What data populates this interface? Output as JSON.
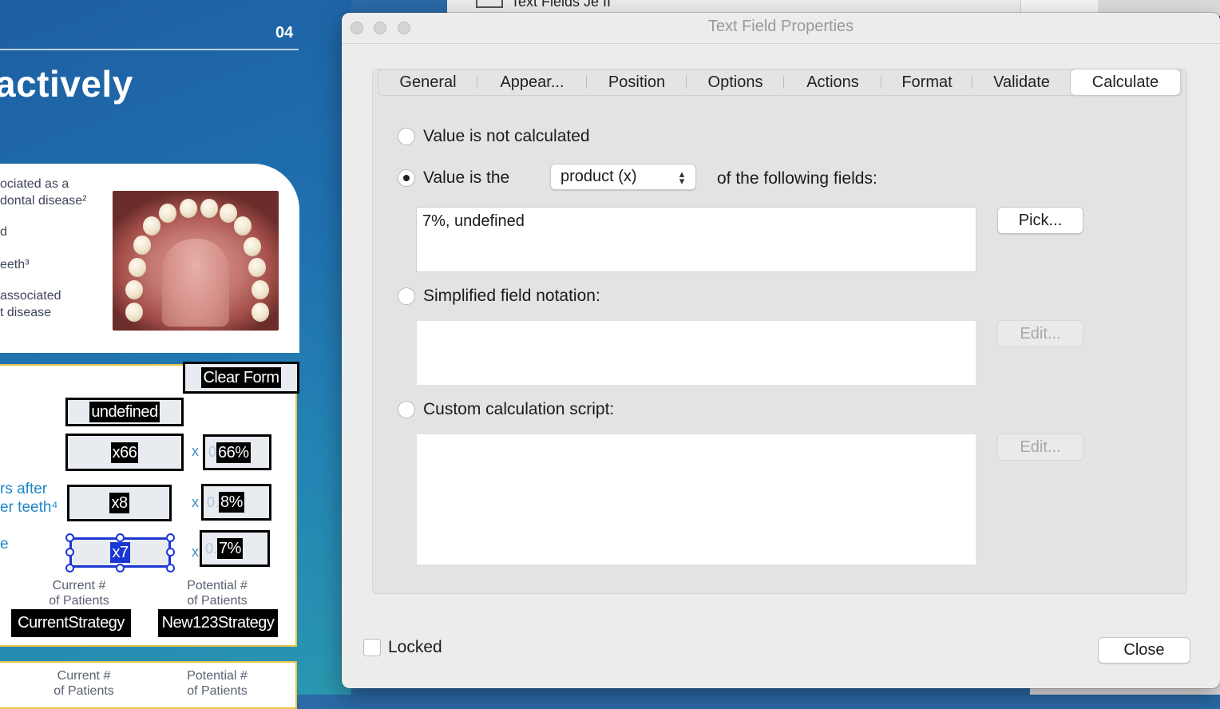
{
  "document": {
    "page_number": "04",
    "headline": "actively",
    "card_lines": [
      "ociated as a",
      "dontal disease²",
      "d",
      "eeth³",
      "associated",
      "t disease"
    ],
    "clear_form": "Clear Form",
    "field_undefined": "undefined",
    "field_x66": "x66",
    "field_66": "66%",
    "field_x8": "x8",
    "field_8": "8%",
    "field_x7": "x7",
    "field_7": "7%",
    "x_label": "x",
    "ghost_0": "0",
    "ghost_08": "0.",
    "ghost_07": "0.",
    "side_label_1": "rs after",
    "side_label_2": "er teeth⁴",
    "side_label_3": "e",
    "current_patients_1": "Current #",
    "current_patients_2": "of Patients",
    "potential_patients_1": "Potential #",
    "potential_patients_2": "of Patients",
    "current_strategy": "CurrentStrategy",
    "new_strategy": "New123Strategy"
  },
  "behind_window": {
    "title": "Text Fields Je II"
  },
  "dialog": {
    "title": "Text Field Properties",
    "tabs": [
      {
        "label": "General"
      },
      {
        "label": "Appear..."
      },
      {
        "label": "Position"
      },
      {
        "label": "Options"
      },
      {
        "label": "Actions"
      },
      {
        "label": "Format"
      },
      {
        "label": "Validate"
      },
      {
        "label": "Calculate",
        "active": true
      }
    ],
    "calculate": {
      "option_not_calculated": "Value is not calculated",
      "option_value_is_the": "Value is the",
      "operation_selected": "product (x)",
      "of_following_fields": "of the following fields:",
      "fields_value": "7%, undefined",
      "pick_button": "Pick...",
      "option_simplified": "Simplified field notation:",
      "simplified_value": "",
      "edit_button_1": "Edit...",
      "option_custom": "Custom calculation script:",
      "custom_value": "",
      "edit_button_2": "Edit...",
      "selected_option": "value_is_the"
    },
    "locked_label": "Locked",
    "locked_checked": false,
    "close_button": "Close"
  }
}
